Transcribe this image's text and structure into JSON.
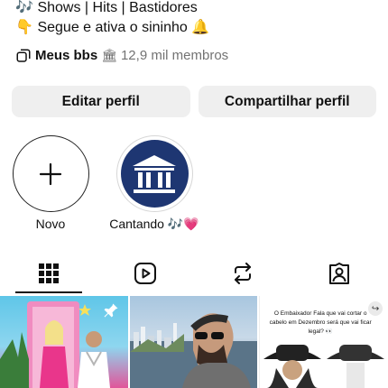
{
  "bio": {
    "line1": "Shows | Hits | Bastidores",
    "line2": "Segue e ativa o sininho",
    "line1_emoji": "🎶",
    "line2_emoji": "👇",
    "line2_trailing_emoji": "🔔"
  },
  "channel": {
    "icon": "broadcast-channel-icon",
    "name": "Meus bbs",
    "emoji": "🏛",
    "members": "12,9 mil membros"
  },
  "actions": {
    "edit_label": "Editar perfil",
    "share_label": "Compartilhar perfil"
  },
  "highlights": [
    {
      "label": "Novo",
      "icon": "plus-icon"
    },
    {
      "label": "Cantando 🎶💗",
      "icon": "bank-icon"
    }
  ],
  "tabs": [
    {
      "name": "grid",
      "icon": "grid-icon",
      "active": true
    },
    {
      "name": "reels",
      "icon": "reels-icon",
      "active": false
    },
    {
      "name": "reposts",
      "icon": "repost-icon",
      "active": false
    },
    {
      "name": "tagged",
      "icon": "tagged-user-icon",
      "active": false
    }
  ],
  "posts": [
    {
      "pinned": true
    },
    {
      "pinned": false
    },
    {
      "caption": "O Embaixador Fala que vai cortar o cabelo em Dezembro será que vai ficar legal? 👀"
    }
  ]
}
